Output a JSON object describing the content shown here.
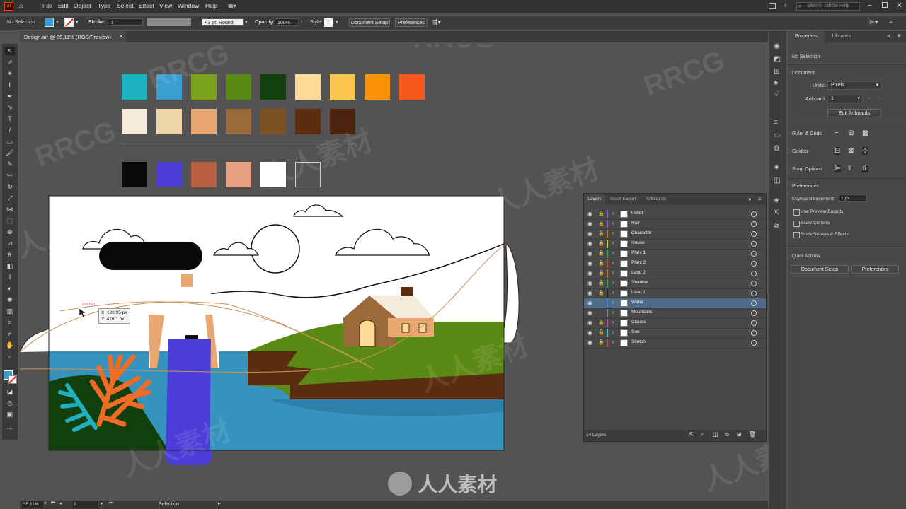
{
  "menubar": {
    "items": [
      "File",
      "Edit",
      "Object",
      "Type",
      "Select",
      "Effect",
      "View",
      "Window",
      "Help"
    ],
    "search_placeholder": "Search Adobe Help"
  },
  "options": {
    "selection": "No Selection",
    "stroke_label": "Stroke:",
    "brush": "3 pt. Round",
    "opacity_label": "Opacity:",
    "opacity_value": "100%",
    "style_label": "Style:",
    "document_setup": "Document Setup",
    "preferences": "Preferences"
  },
  "document_tab": {
    "title": "Design.ai* @ 35,11% (RGB/Preview)"
  },
  "palette": {
    "row1": [
      "#1fb0c2",
      "#3a9ed0",
      "#7aa21a",
      "#5a8a14",
      "#12400d",
      "#fcdb98",
      "#fbc54e",
      "#fb9206",
      "#f6581c"
    ],
    "row2": [
      "#f4ebdc",
      "#efd6a6",
      "#e9a772",
      "#9a6b39",
      "#7b5024",
      "#5a2c10",
      "#4c240e"
    ],
    "row3": [
      "#0a0a0a",
      "#4a3dd9",
      "#b85f42",
      "#e6a183",
      "#ffffff",
      "#555555"
    ]
  },
  "tooltip": {
    "label": "anchor",
    "x": "X: 128,95 px",
    "y": "Y: 478,1 px"
  },
  "layers_panel": {
    "tabs": [
      "Layers",
      "Asset Export",
      "Artboards"
    ],
    "layers": [
      {
        "name": "t-shirt",
        "color": "#8a63d2"
      },
      {
        "name": "Hair",
        "color": "#8a63d2"
      },
      {
        "name": "Character",
        "color": "#d27a24"
      },
      {
        "name": "House",
        "color": "#d2d224"
      },
      {
        "name": "Plant 1",
        "color": "#24b45a"
      },
      {
        "name": "Plant 2",
        "color": "#d24b24"
      },
      {
        "name": "Land 2",
        "color": "#d27a24"
      },
      {
        "name": "Shadow",
        "color": "#24b45a"
      },
      {
        "name": "Land 1",
        "color": "#222222"
      },
      {
        "name": "Water",
        "color": "#4b86d2"
      },
      {
        "name": "Mountains",
        "color": "#8a8a8a"
      },
      {
        "name": "Clouds",
        "color": "#d24b9a"
      },
      {
        "name": "Sun",
        "color": "#4bc3d2"
      },
      {
        "name": "Sketch",
        "color": "#d24b4b"
      }
    ],
    "footer": "14 Layers"
  },
  "properties_panel": {
    "tabs": [
      "Properties",
      "Libraries"
    ],
    "no_selection": "No Selection",
    "document_label": "Document",
    "units_label": "Units:",
    "units_value": "Pixels",
    "artboard_label": "Artboard:",
    "artboard_value": "1",
    "edit_artboards": "Edit Artboards",
    "rulers_grids": "Ruler & Grids",
    "guides": "Guides",
    "snap_options": "Snap Options",
    "preferences_label": "Preferences",
    "keyboard_increment_label": "Keyboard Increment:",
    "keyboard_increment_value": "1 px",
    "use_preview_bounds": "Use Preview Bounds",
    "scale_corners": "Scale Corners",
    "scale_strokes": "Scale Strokes & Effects",
    "quick_actions": "Quick Actions",
    "document_setup_btn": "Document Setup",
    "preferences_btn": "Preferences"
  },
  "status": {
    "zoom": "35,11%",
    "artboard": "1",
    "mode": "Selection"
  },
  "watermark": {
    "text1": "RRCG",
    "text2": "人人素材"
  }
}
